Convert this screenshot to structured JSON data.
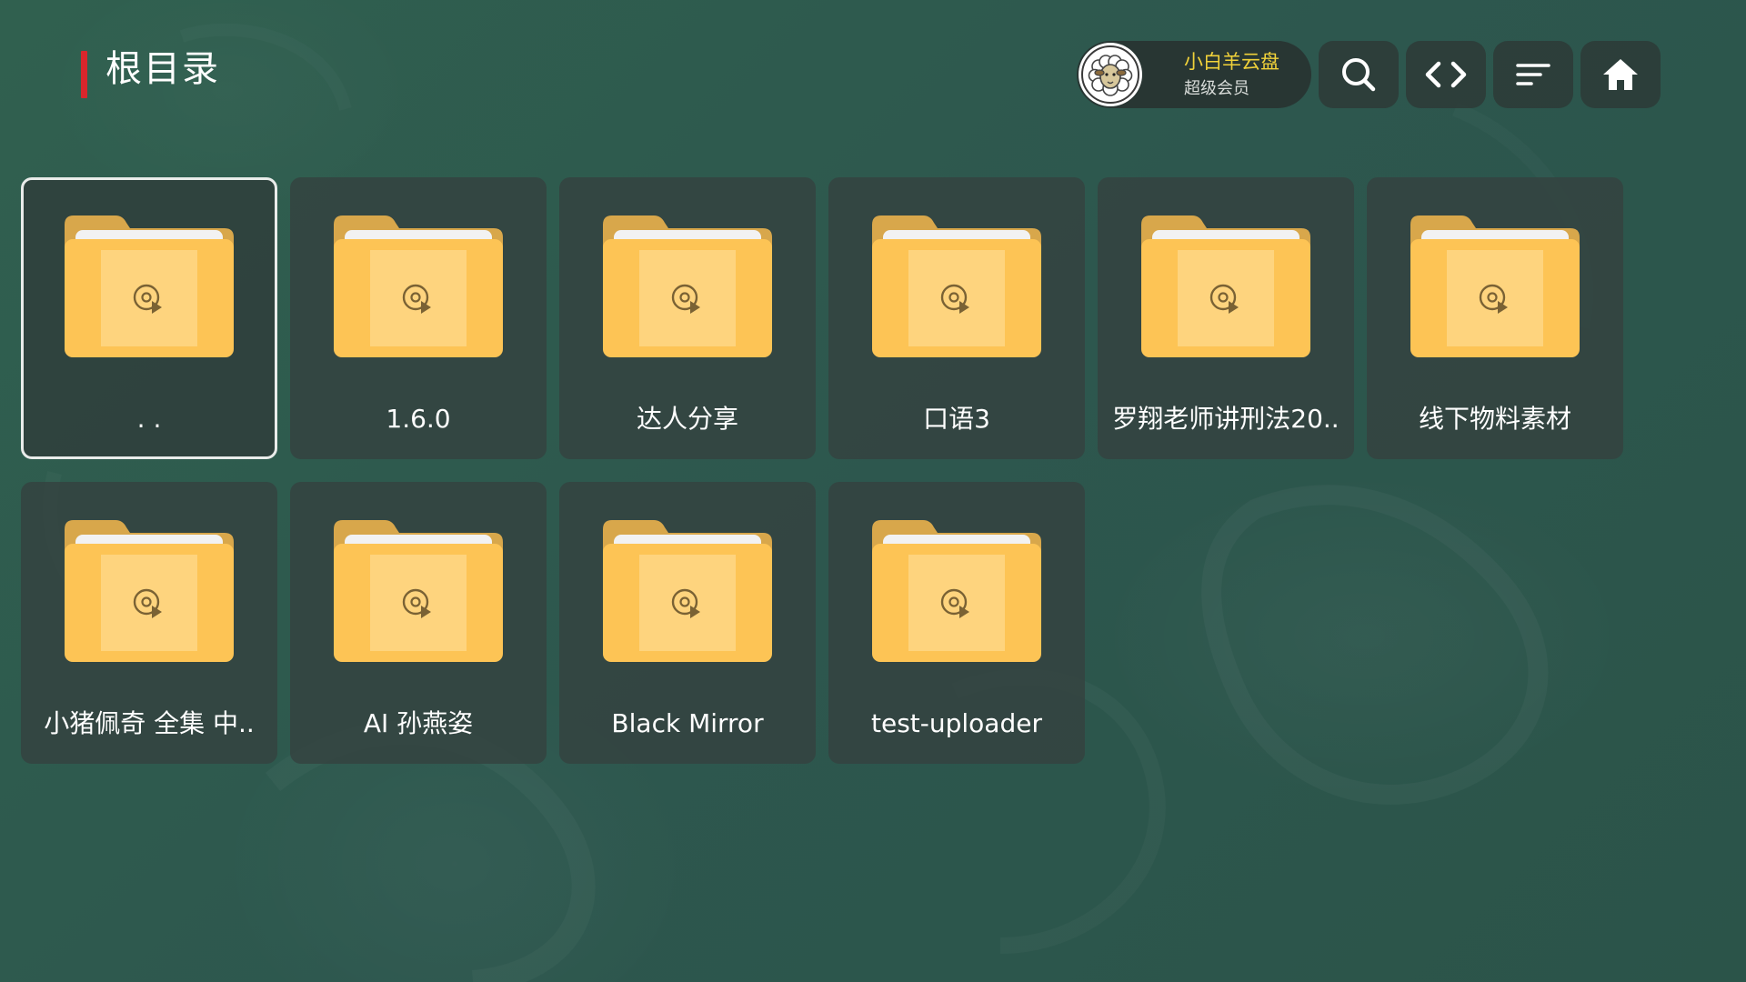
{
  "header": {
    "title": "根目录",
    "account": {
      "name": "小白羊云盘",
      "level": "超级会员"
    },
    "toolbar": {
      "search_icon": "search-icon",
      "code_icon": "code-brackets-icon",
      "sort_icon": "sort-icon",
      "home_icon": "home-icon"
    }
  },
  "folders": [
    {
      "label": ". .",
      "selected": true,
      "icon": "video-folder-icon"
    },
    {
      "label": "1.6.0",
      "icon": "video-folder-icon"
    },
    {
      "label": "达人分享",
      "icon": "video-folder-icon"
    },
    {
      "label": "口语3",
      "icon": "video-folder-icon"
    },
    {
      "label": "罗翔老师讲刑法20..",
      "icon": "video-folder-icon"
    },
    {
      "label": "线下物料素材",
      "icon": "video-folder-icon"
    },
    {
      "label": "小猪佩奇  全集 中..",
      "icon": "video-folder-icon"
    },
    {
      "label": "AI 孙燕姿",
      "icon": "video-folder-icon"
    },
    {
      "label": "Black Mirror",
      "icon": "video-folder-icon"
    },
    {
      "label": "test-uploader",
      "icon": "video-folder-icon"
    }
  ],
  "colors": {
    "accent": "#d9262c",
    "folder": "#fdc455",
    "folder_tab": "#d8a74b",
    "account_name": "#f1d23a"
  }
}
